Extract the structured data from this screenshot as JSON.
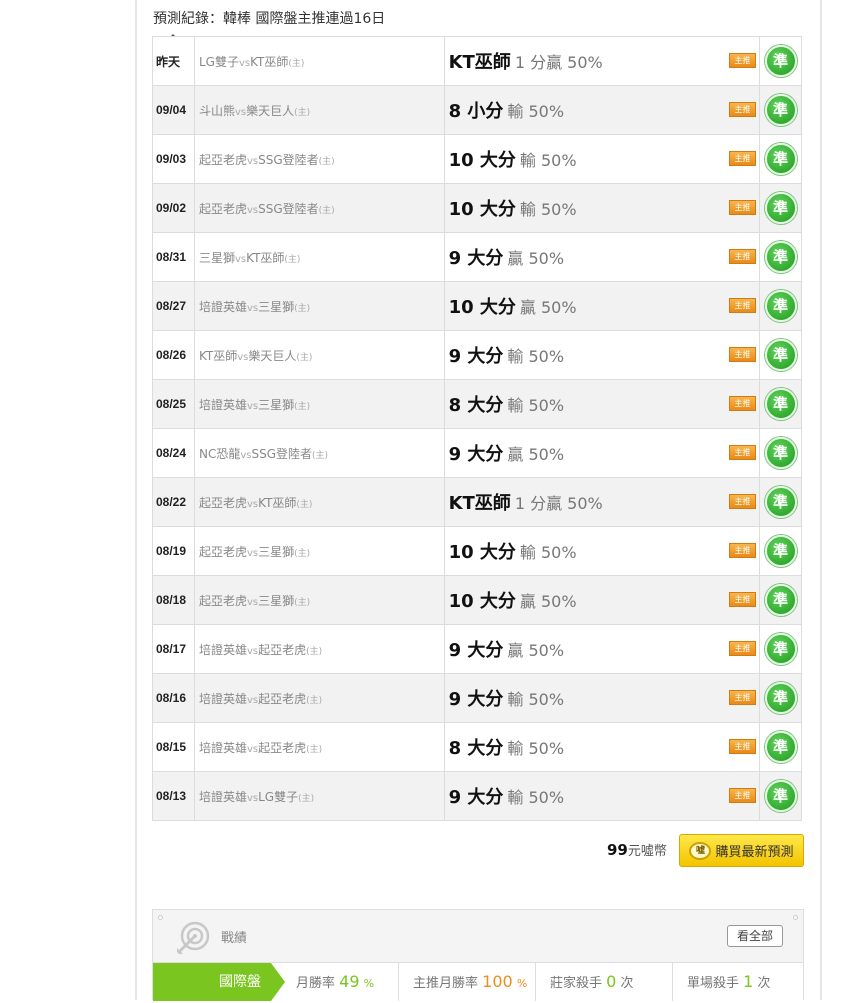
{
  "section_title": "預測紀錄：韓棒 國際盤主推連過16日",
  "records": [
    {
      "date": "昨天",
      "home": "LG雙子",
      "vs": "vs",
      "away": "KT巫師",
      "host_mark": "(主)",
      "pick": "KT巫師",
      "result": "1 分贏 50%",
      "badge": "主推",
      "verdict": "準"
    },
    {
      "date": "09/04",
      "home": "斗山熊",
      "vs": "vs",
      "away": "樂天巨人",
      "host_mark": "(主)",
      "pick": "8 小分",
      "result": "輸 50%",
      "badge": "主推",
      "verdict": "準"
    },
    {
      "date": "09/03",
      "home": "起亞老虎",
      "vs": "vs",
      "away": "SSG登陸者",
      "host_mark": "(主)",
      "pick": "10 大分",
      "result": "輸 50%",
      "badge": "主推",
      "verdict": "準"
    },
    {
      "date": "09/02",
      "home": "起亞老虎",
      "vs": "vs",
      "away": "SSG登陸者",
      "host_mark": "(主)",
      "pick": "10 大分",
      "result": "輸 50%",
      "badge": "主推",
      "verdict": "準"
    },
    {
      "date": "08/31",
      "home": "三星獅",
      "vs": "vs",
      "away": "KT巫師",
      "host_mark": "(主)",
      "pick": "9 大分",
      "result": "贏 50%",
      "badge": "主推",
      "verdict": "準"
    },
    {
      "date": "08/27",
      "home": "培證英雄",
      "vs": "vs",
      "away": "三星獅",
      "host_mark": "(主)",
      "pick": "10 大分",
      "result": "贏 50%",
      "badge": "主推",
      "verdict": "準"
    },
    {
      "date": "08/26",
      "home": "KT巫師",
      "vs": "vs",
      "away": "樂天巨人",
      "host_mark": "(主)",
      "pick": "9 大分",
      "result": "輸 50%",
      "badge": "主推",
      "verdict": "準"
    },
    {
      "date": "08/25",
      "home": "培證英雄",
      "vs": "vs",
      "away": "三星獅",
      "host_mark": "(主)",
      "pick": "8 大分",
      "result": "輸 50%",
      "badge": "主推",
      "verdict": "準"
    },
    {
      "date": "08/24",
      "home": "NC恐龍",
      "vs": "vs",
      "away": "SSG登陸者",
      "host_mark": "(主)",
      "pick": "9 大分",
      "result": "贏 50%",
      "badge": "主推",
      "verdict": "準"
    },
    {
      "date": "08/22",
      "home": "起亞老虎",
      "vs": "vs",
      "away": "KT巫師",
      "host_mark": "(主)",
      "pick": "KT巫師",
      "result": "1 分贏 50%",
      "badge": "主推",
      "verdict": "準"
    },
    {
      "date": "08/19",
      "home": "起亞老虎",
      "vs": "vs",
      "away": "三星獅",
      "host_mark": "(主)",
      "pick": "10 大分",
      "result": "輸 50%",
      "badge": "主推",
      "verdict": "準"
    },
    {
      "date": "08/18",
      "home": "起亞老虎",
      "vs": "vs",
      "away": "三星獅",
      "host_mark": "(主)",
      "pick": "10 大分",
      "result": "贏 50%",
      "badge": "主推",
      "verdict": "準"
    },
    {
      "date": "08/17",
      "home": "培證英雄",
      "vs": "vs",
      "away": "起亞老虎",
      "host_mark": "(主)",
      "pick": "9 大分",
      "result": "贏 50%",
      "badge": "主推",
      "verdict": "準"
    },
    {
      "date": "08/16",
      "home": "培證英雄",
      "vs": "vs",
      "away": "起亞老虎",
      "host_mark": "(主)",
      "pick": "9 大分",
      "result": "輸 50%",
      "badge": "主推",
      "verdict": "準"
    },
    {
      "date": "08/15",
      "home": "培證英雄",
      "vs": "vs",
      "away": "起亞老虎",
      "host_mark": "(主)",
      "pick": "8 大分",
      "result": "輸 50%",
      "badge": "主推",
      "verdict": "準"
    },
    {
      "date": "08/13",
      "home": "培證英雄",
      "vs": "vs",
      "away": "LG雙子",
      "host_mark": "(主)",
      "pick": "9 大分",
      "result": "輸 50%",
      "badge": "主推",
      "verdict": "準"
    }
  ],
  "purchase": {
    "price": "99",
    "unit": "元噓幣",
    "coin_label": "噓",
    "button_label": "購買最新預測"
  },
  "stats": {
    "title": "戰績",
    "view_all": "看全部",
    "tab": "國際盤",
    "monthly_label": "月勝率",
    "monthly_value": "49",
    "monthly_unit": "%",
    "main_label": "主推月勝率",
    "main_value": "100",
    "main_unit": "%",
    "banker_label": "莊家殺手",
    "banker_value": "0",
    "banker_unit": "次",
    "single_label": "單場殺手",
    "single_value": "1",
    "single_unit": "次"
  },
  "colors": {
    "accent_green": "#7ac51f",
    "accent_orange": "#f08c1f",
    "button_yellow": "#f3c400"
  }
}
